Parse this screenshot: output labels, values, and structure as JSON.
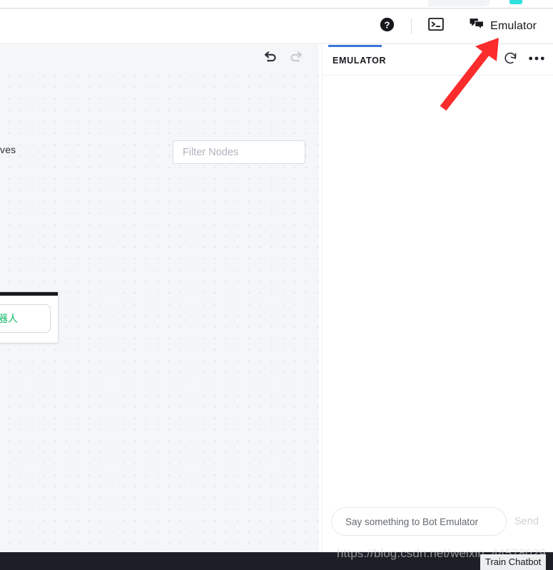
{
  "header": {
    "help_icon": "help-circle-icon",
    "console_icon": "terminal-icon",
    "emulator_icon": "chat-bubbles-icon",
    "emulator_label": "Emulator"
  },
  "canvas": {
    "undo_icon": "undo-arrow-icon",
    "redo_icon": "redo-arrow-icon",
    "truncated_label": "ves",
    "filter_placeholder": "Filter Nodes",
    "filter_value": "",
    "node": {
      "chip_text": "ss机器人",
      "chip_color": "#0fb765"
    }
  },
  "emulator": {
    "tab_label": "EMULATOR",
    "tab_accent": "#3a76d8",
    "restart_icon": "restart-circular-arrow-icon",
    "more_icon": "more-horizontal-icon",
    "composer_placeholder": "Say something to Bot Emulator",
    "composer_value": "",
    "send_label": "Send"
  },
  "footer": {
    "watermark": "https://blog.csdn.net/weixin_44578029",
    "tooltip": "Train Chatbot"
  },
  "annotation": {
    "arrow_color": "#fb2c2c"
  }
}
